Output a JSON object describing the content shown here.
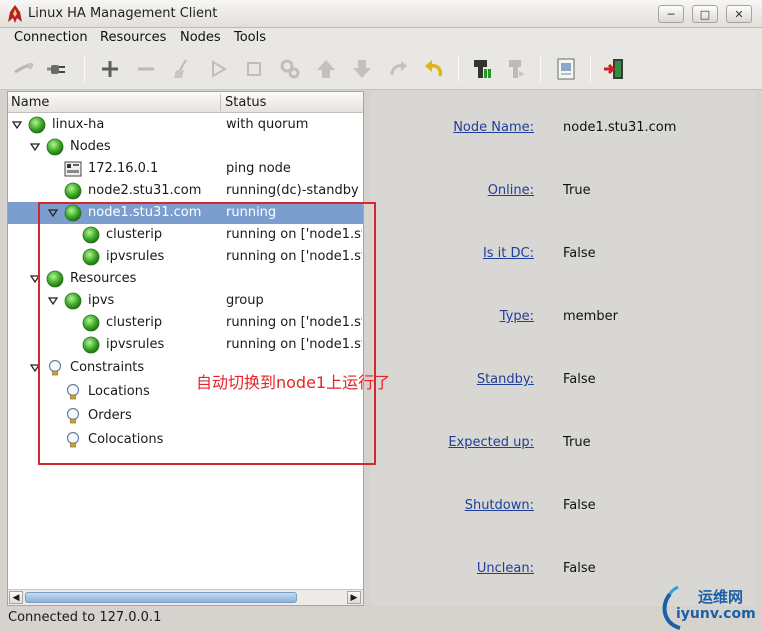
{
  "window": {
    "title": "Linux HA Management Client",
    "controls": [
      "minimize",
      "maximize",
      "close"
    ]
  },
  "menu": [
    "Connection",
    "Resources",
    "Nodes",
    "Tools"
  ],
  "toolbar": {
    "icons": [
      "disconnect-icon",
      "connect-icon",
      "add-icon",
      "remove-icon",
      "cleanup-icon",
      "start-icon",
      "stop-icon",
      "manage-icon",
      "move-up-icon",
      "move-down-icon",
      "redo-icon",
      "undo-icon",
      "standby-icon",
      "active-icon",
      "view-xml-icon",
      "exit-icon"
    ]
  },
  "tree": {
    "columns": {
      "name": "Name",
      "status": "Status"
    },
    "rows": [
      {
        "label": "linux-ha",
        "status": "with quorum",
        "icon": "green-dot",
        "level": 0,
        "expanded": true
      },
      {
        "label": "Nodes",
        "status": "",
        "icon": "green-dot",
        "level": 1,
        "expanded": true
      },
      {
        "label": "172.16.0.1",
        "status": "ping node",
        "icon": "ping-node",
        "level": 2,
        "expanded": null
      },
      {
        "label": "node2.stu31.com",
        "status": "running(dc)-standby",
        "icon": "green-dot",
        "level": 2,
        "expanded": null
      },
      {
        "label": "node1.stu31.com",
        "status": "running",
        "icon": "green-dot",
        "level": 2,
        "expanded": true,
        "selected": true
      },
      {
        "label": "clusterip",
        "status": "running on ['node1.st",
        "icon": "green-dot",
        "level": 3,
        "expanded": null
      },
      {
        "label": "ipvsrules",
        "status": "running on ['node1.st",
        "icon": "green-dot",
        "level": 3,
        "expanded": null
      },
      {
        "label": "Resources",
        "status": "",
        "icon": "green-dot",
        "level": 1,
        "expanded": true
      },
      {
        "label": "ipvs",
        "status": "group",
        "icon": "green-dot",
        "level": 2,
        "expanded": true
      },
      {
        "label": "clusterip",
        "status": "running on ['node1.st",
        "icon": "green-dot",
        "level": 3,
        "expanded": null
      },
      {
        "label": "ipvsrules",
        "status": "running on ['node1.st",
        "icon": "green-dot",
        "level": 3,
        "expanded": null
      },
      {
        "label": "Constraints",
        "status": "",
        "icon": "bulb",
        "level": 1,
        "expanded": true
      },
      {
        "label": "Locations",
        "status": "",
        "icon": "bulb",
        "level": 2,
        "expanded": null
      },
      {
        "label": "Orders",
        "status": "",
        "icon": "bulb",
        "level": 2,
        "expanded": null
      },
      {
        "label": "Colocations",
        "status": "",
        "icon": "bulb",
        "level": 2,
        "expanded": null
      }
    ]
  },
  "properties": [
    {
      "label": "Node Name:",
      "value": "node1.stu31.com"
    },
    {
      "label": "Online:",
      "value": "True"
    },
    {
      "label": "Is it DC:",
      "value": "False"
    },
    {
      "label": "Type:",
      "value": "member"
    },
    {
      "label": "Standby:",
      "value": "False"
    },
    {
      "label": "Expected up:",
      "value": "True"
    },
    {
      "label": "Shutdown:",
      "value": "False"
    },
    {
      "label": "Unclean:",
      "value": "False"
    }
  ],
  "status_bar": {
    "text": "Connected to 127.0.0.1"
  },
  "annotation": {
    "text": "自动切换到node1上运行了",
    "color": "#e8232a"
  },
  "watermark": {
    "top": "运维网",
    "bottom": "iyunv.com"
  },
  "colors": {
    "selection": "#7c9ecf",
    "link": "#1f3e9c",
    "status_green": "#3fae2a",
    "highlight_border": "#d2282e"
  }
}
